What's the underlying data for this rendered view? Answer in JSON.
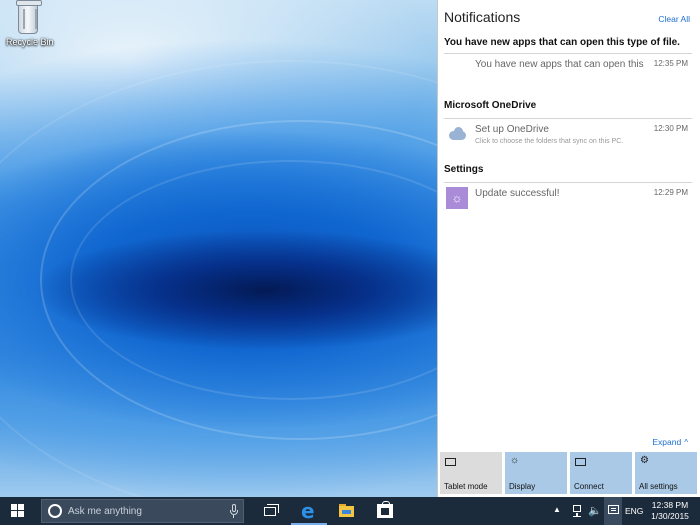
{
  "desktop": {
    "icons": [
      {
        "label": "Recycle Bin",
        "icon": "recycle-bin-icon"
      }
    ]
  },
  "action_center": {
    "title": "Notifications",
    "clear_all": "Clear All",
    "groups": [
      {
        "title": "You have new apps that can open this type of file.",
        "items": [
          {
            "title": "You have new apps that can open this",
            "subtitle": "",
            "time": "12:35 PM",
            "icon": ""
          }
        ]
      },
      {
        "title": "Microsoft OneDrive",
        "items": [
          {
            "title": "Set up OneDrive",
            "subtitle": "Click to choose the folders that sync on this PC.",
            "time": "12:30 PM",
            "icon": "cloud-icon"
          }
        ]
      },
      {
        "title": "Settings",
        "items": [
          {
            "title": "Update successful!",
            "subtitle": "",
            "time": "12:29 PM",
            "icon": "settings-gear-icon"
          }
        ]
      }
    ],
    "expand_label": "Expand",
    "quick_actions": [
      {
        "label": "Tablet mode",
        "icon": "tablet-mode-icon",
        "active": false
      },
      {
        "label": "Display",
        "icon": "display-icon",
        "active": true
      },
      {
        "label": "Connect",
        "icon": "connect-icon",
        "active": true
      },
      {
        "label": "All settings",
        "icon": "gear-icon",
        "active": true
      }
    ]
  },
  "taskbar": {
    "search_placeholder": "Ask me anything",
    "pinned": [
      {
        "name": "Task View",
        "icon": "task-view-icon"
      },
      {
        "name": "Microsoft Edge",
        "icon": "edge-icon"
      },
      {
        "name": "File Explorer",
        "icon": "file-explorer-icon"
      },
      {
        "name": "Store",
        "icon": "store-icon"
      }
    ],
    "tray": {
      "language": "ENG",
      "time": "12:38 PM",
      "date": "1/30/2015"
    }
  },
  "colors": {
    "taskbar": "#1c2b3c",
    "accent": "#1a6fd0",
    "tile_active": "#aac9e7",
    "tile_inactive": "#dcdcdc",
    "settings_icon": "#a98bd8"
  }
}
